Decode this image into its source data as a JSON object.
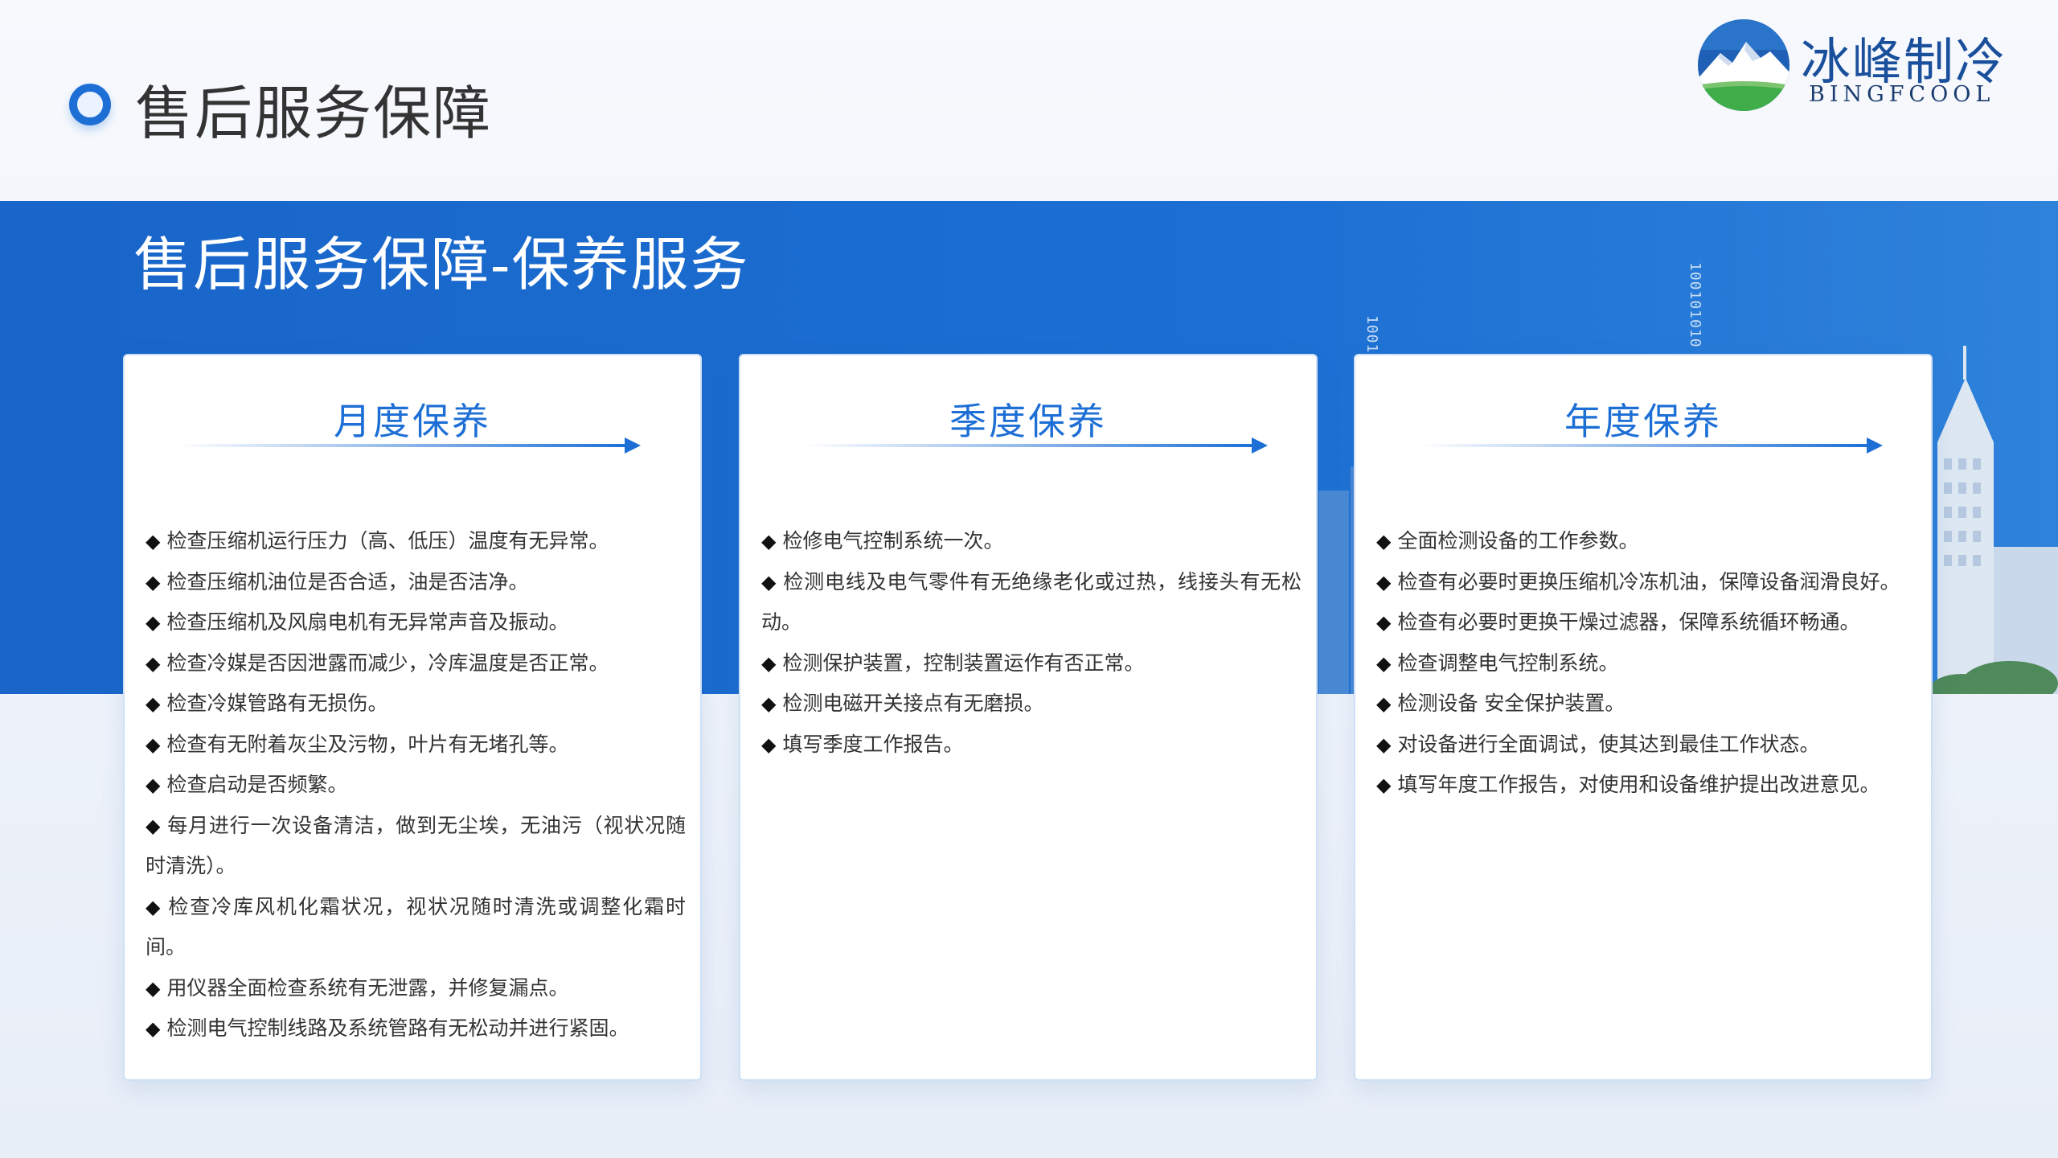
{
  "header": {
    "title": "售后服务保障"
  },
  "logo": {
    "name_cn": "冰峰制冷",
    "name_en": "BINGFCOOL"
  },
  "band": {
    "title": "售后服务保障-保养服务",
    "binary_1": "1001",
    "binary_2": "100101010"
  },
  "colors": {
    "accent": "#1d6fd6",
    "band": "#1c6fd3",
    "text": "#333333"
  },
  "icons": {
    "bullet": "diamond-icon",
    "arrow": "arrow-right-icon",
    "logo": "mountain-logo-icon"
  },
  "cards": [
    {
      "title": "月度保养",
      "items": [
        "检查压缩机运行压力（高、低压）温度有无异常。",
        "检查压缩机油位是否合适，油是否洁净。",
        "检查压缩机及风扇电机有无异常声音及振动。",
        "检查冷媒是否因泄露而减少，冷库温度是否正常。",
        "检查冷媒管路有无损伤。",
        "检查有无附着灰尘及污物，叶片有无堵孔等。",
        "检查启动是否频繁。",
        "每月进行一次设备清洁，做到无尘埃，无油污（视状况随时清洗）。",
        "检查冷库风机化霜状况，视状况随时清洗或调整化霜时间。",
        "用仪器全面检查系统有无泄露，并修复漏点。",
        "检测电气控制线路及系统管路有无松动并进行紧固。"
      ]
    },
    {
      "title": "季度保养",
      "items": [
        "检修电气控制系统一次。",
        "检测电线及电气零件有无绝缘老化或过热，线接头有无松动。",
        "检测保护装置，控制装置运作有否正常。",
        "检测电磁开关接点有无磨损。",
        "填写季度工作报告。"
      ]
    },
    {
      "title": "年度保养",
      "items": [
        "全面检测设备的工作参数。",
        "检查有必要时更换压缩机冷冻机油，保障设备润滑良好。",
        "检查有必要时更换干燥过滤器，保障系统循环畅通。",
        "检查调整电气控制系统。",
        "检测设备 安全保护装置。",
        "对设备进行全面调试，使其达到最佳工作状态。",
        "填写年度工作报告，对使用和设备维护提出改进意见。"
      ]
    }
  ]
}
